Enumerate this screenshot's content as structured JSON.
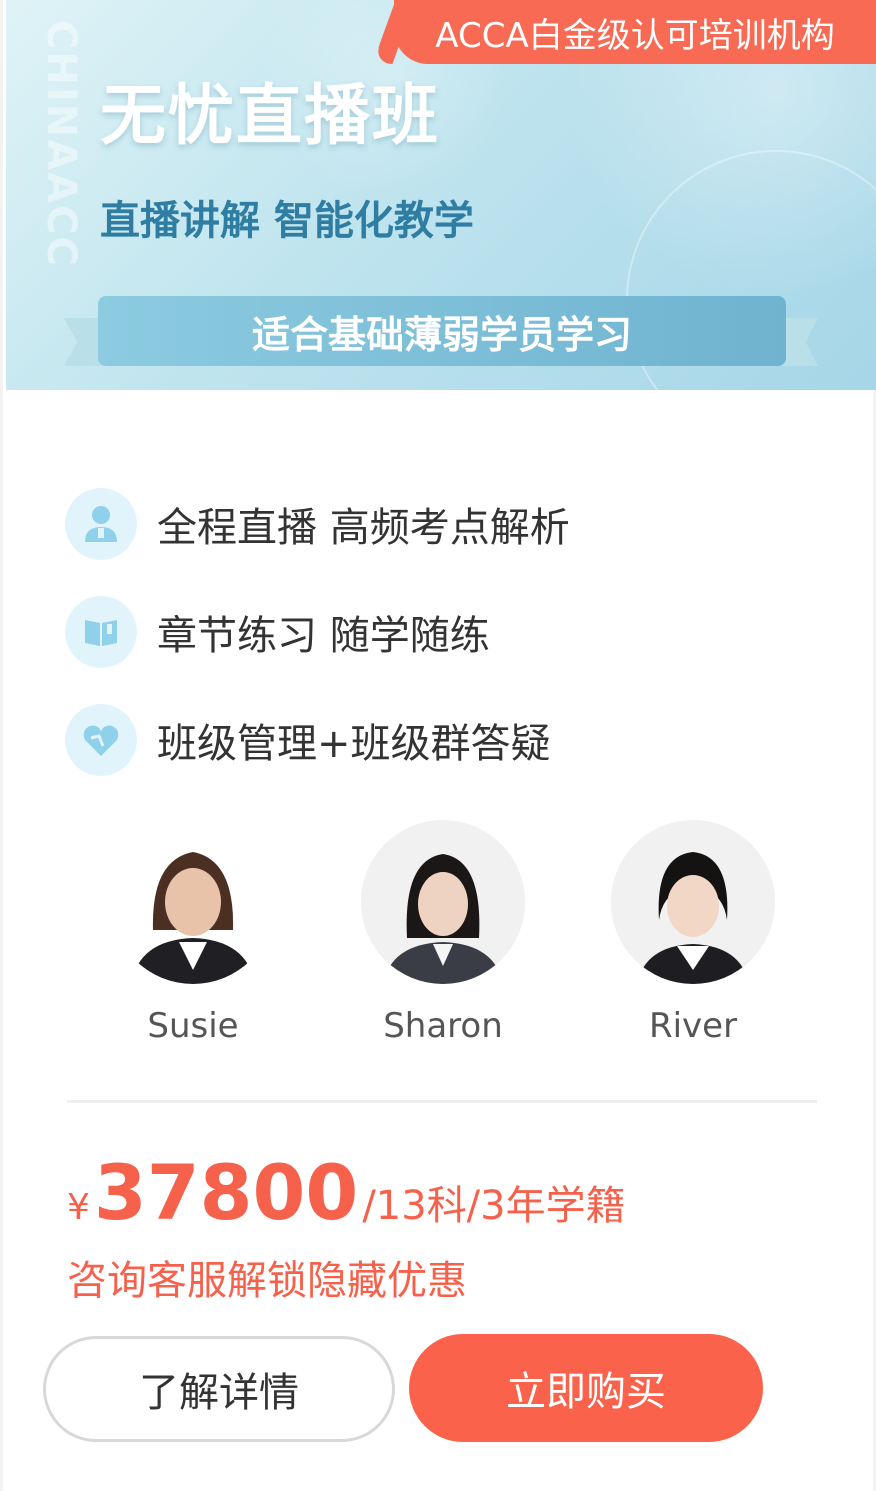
{
  "banner": {
    "watermark": "CHINAACC",
    "badge": "ACCA白金级认可培训机构",
    "title": "无忧直播班",
    "subtitle": "直播讲解 智能化教学",
    "ribbon": "适合基础薄弱学员学习"
  },
  "features": [
    {
      "icon": "teacher-icon",
      "text": "全程直播 高频考点解析"
    },
    {
      "icon": "book-icon",
      "text": "章节练习 随学随练"
    },
    {
      "icon": "heart-icon",
      "text": "班级管理+班级群答疑"
    }
  ],
  "teachers": [
    {
      "name": "Susie"
    },
    {
      "name": "Sharon"
    },
    {
      "name": "River"
    }
  ],
  "price": {
    "currency": "¥",
    "amount": "37800",
    "unit": "/13科/3年学籍"
  },
  "promo": "咨询客服解锁隐藏优惠",
  "buttons": {
    "details": "了解详情",
    "buy": "立即购买"
  },
  "colors": {
    "accent": "#f96a55",
    "banner_sub": "#2f7da2",
    "icon_bg": "#e2f4fb",
    "icon_fg": "#8fd0ea"
  }
}
